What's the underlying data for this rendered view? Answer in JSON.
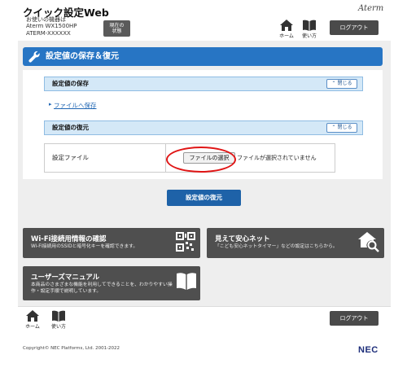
{
  "header": {
    "title": "クイック設定Web",
    "device_line1": "お使いの機器は",
    "device_line2": "Aterm WX1500HP",
    "device_line3": "ATERM-XXXXXX",
    "status_button": "現在の\n状態",
    "brand": "Aterm",
    "home_label": "ホーム",
    "help_label": "使い方",
    "logout_label": "ログアウト"
  },
  "main": {
    "section_title": "設定値の保存＆復元",
    "save_header": "設定値の保存",
    "save_close": "閉じる",
    "save_link": "ファイルへ保存",
    "restore_header": "設定値の復元",
    "restore_close": "閉じる",
    "file_label": "設定ファイル",
    "file_button": "ファイルの選択",
    "file_status": "ファイルが選択されていません",
    "restore_button": "設定値の復元"
  },
  "cards": {
    "wifi_title": "Wi-Fi接続用情報の確認",
    "wifi_desc": "Wi-Fi接続用のSSIDと暗号化キーを確認できます。",
    "safety_title": "見えて安心ネット",
    "safety_desc": "「こども安心ネットタイマー」などの設定はこちらから。",
    "manual_title": "ユーザーズマニュアル",
    "manual_desc_1": "本商品のさまざまな機能を利用してできることを、わかりやすい操",
    "manual_desc_2": "作・設定手順で説明しています。"
  },
  "footer": {
    "home_label": "ホーム",
    "help_label": "使い方",
    "logout_label": "ログアウト",
    "copyright": "Copyright© NEC Platforms, Ltd. 2001-2022",
    "nec_logo": "NEC"
  },
  "colors": {
    "accent": "#2775c4",
    "subheader": "#d4e8f7",
    "card": "#4f4f4f",
    "highlight_ring": "#e01515"
  }
}
